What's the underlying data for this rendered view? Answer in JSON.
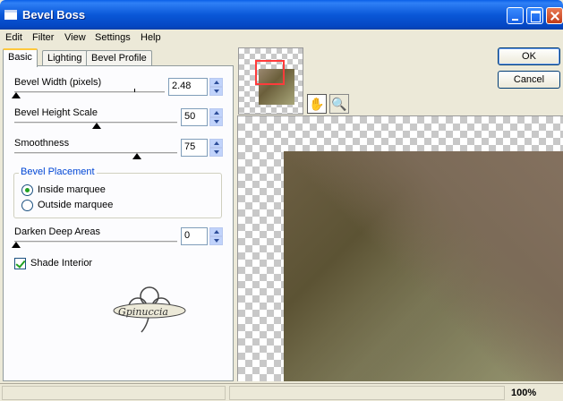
{
  "window": {
    "title": "Bevel Boss"
  },
  "menu": [
    "Edit",
    "Filter",
    "View",
    "Settings",
    "Help"
  ],
  "tabs": [
    "Basic",
    "Lighting",
    "Bevel Profile"
  ],
  "active_tab": "Basic",
  "controls": {
    "bevel_width": {
      "label": "Bevel Width (pixels)",
      "value": "2.48"
    },
    "bevel_height": {
      "label": "Bevel Height Scale",
      "value": "50"
    },
    "smoothness": {
      "label": "Smoothness",
      "value": "75"
    },
    "darken_deep": {
      "label": "Darken Deep Areas",
      "value": "0"
    }
  },
  "bevel_placement": {
    "title": "Bevel Placement",
    "options": [
      "Inside marquee",
      "Outside marquee"
    ],
    "selected": "Inside marquee"
  },
  "shade_interior": {
    "label": "Shade Interior",
    "checked": true
  },
  "logo": {
    "text": "Gpinuccia"
  },
  "buttons": {
    "ok": "OK",
    "cancel": "Cancel"
  },
  "tools": {
    "pan": "hand-icon",
    "zoom": "magnifier-icon"
  },
  "status": {
    "zoom": "100%"
  },
  "colors": {
    "title_bar": "#0a58d8",
    "group_title": "#0046d5",
    "tab_accent": "#ffc83c",
    "preview_rect": "#ff3b3b"
  }
}
